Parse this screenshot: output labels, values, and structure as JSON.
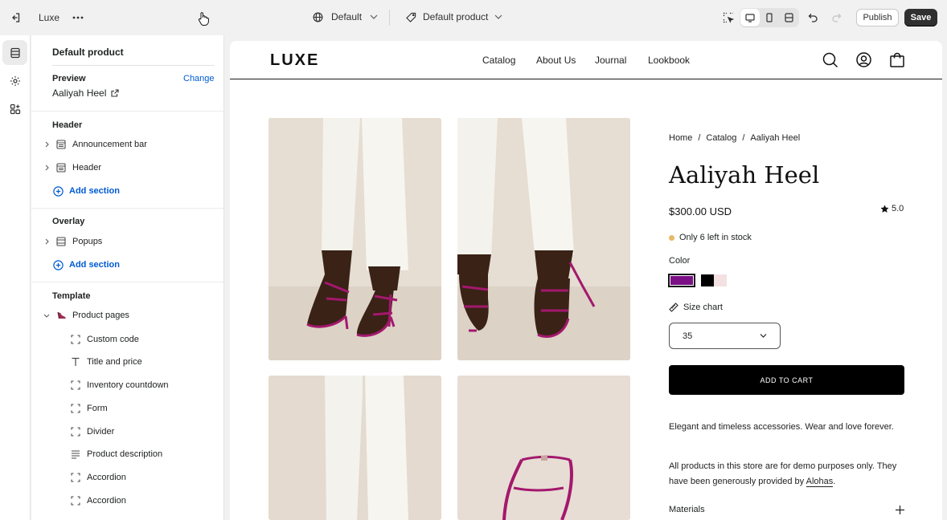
{
  "topbar": {
    "store_name": "Luxe",
    "theme_label": "Default",
    "template_label": "Default product",
    "publish_label": "Publish",
    "save_label": "Save"
  },
  "sidebar": {
    "title": "Default product",
    "preview": {
      "heading": "Preview",
      "change_label": "Change",
      "product": "Aaliyah Heel"
    },
    "header_group": {
      "heading": "Header",
      "items": [
        {
          "label": "Announcement bar",
          "icon": "section-icon"
        },
        {
          "label": "Header",
          "icon": "section-icon"
        }
      ],
      "add_label": "Add section"
    },
    "overlay_group": {
      "heading": "Overlay",
      "items": [
        {
          "label": "Popups",
          "icon": "section-icon"
        }
      ],
      "add_label": "Add section"
    },
    "template_group": {
      "heading": "Template",
      "section_label": "Product pages",
      "blocks": [
        {
          "label": "Custom code",
          "icon": "block-dashed-icon"
        },
        {
          "label": "Title and price",
          "icon": "text-t-icon"
        },
        {
          "label": "Inventory countdown",
          "icon": "block-dashed-icon"
        },
        {
          "label": "Form",
          "icon": "block-dashed-icon"
        },
        {
          "label": "Divider",
          "icon": "block-dashed-icon"
        },
        {
          "label": "Product description",
          "icon": "text-lines-icon"
        },
        {
          "label": "Accordion",
          "icon": "block-dashed-icon"
        },
        {
          "label": "Accordion",
          "icon": "block-dashed-icon"
        }
      ]
    }
  },
  "store": {
    "logo": "LUXE",
    "nav": [
      "Catalog",
      "About Us",
      "Journal",
      "Lookbook"
    ],
    "breadcrumb": [
      "Home",
      "/",
      "Catalog",
      "/",
      "Aaliyah Heel"
    ],
    "product_title": "Aaliyah Heel",
    "price": "$300.00 USD",
    "rating": "5.0",
    "stock_text": "Only 6 left in stock",
    "color_label": "Color",
    "colors": [
      "#7b0f86",
      "#000000",
      "#f3e1e1"
    ],
    "size_chart_label": "Size chart",
    "size_value": "35",
    "add_to_cart": "ADD TO CART",
    "description_1": "Elegant and timeless accessories. Wear and love forever.",
    "description_2_prefix": "All products in this store are for demo purposes only. They have been generously provided by ",
    "description_2_link": "Alohas",
    "description_2_suffix": ".",
    "accordion_label": "Materials",
    "accent_colors": {
      "stock_dot": "#e8b86a",
      "link": "#005bd3"
    }
  }
}
